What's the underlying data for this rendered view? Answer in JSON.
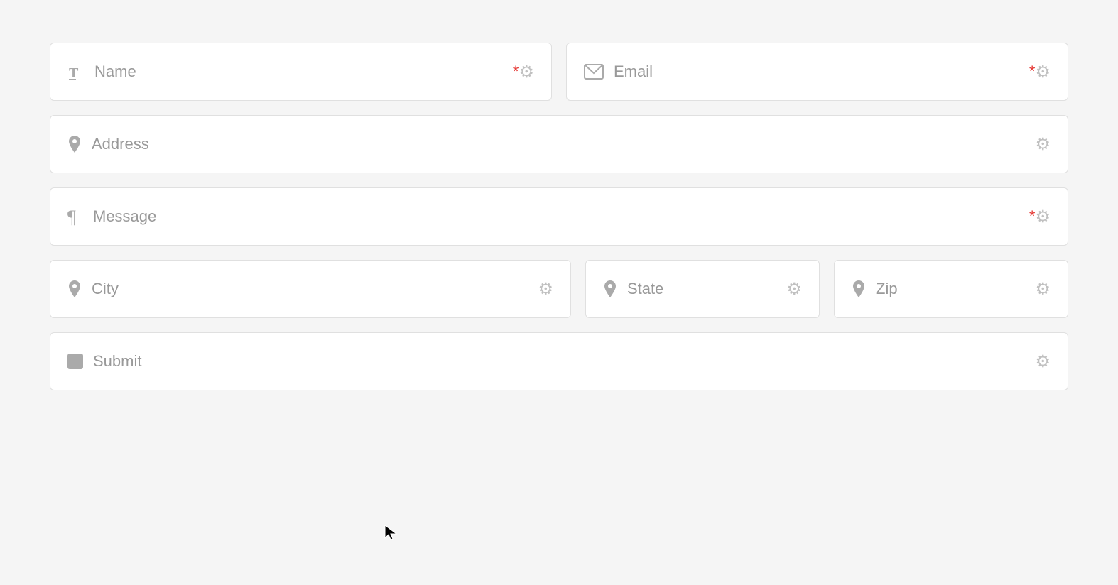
{
  "form": {
    "fields": {
      "name": {
        "label": "Name",
        "required": true,
        "icon": "T",
        "icon_type": "text"
      },
      "email": {
        "label": "Email",
        "required": true,
        "icon": "✉",
        "icon_type": "email"
      },
      "address": {
        "label": "Address",
        "required": false,
        "icon": "📍",
        "icon_type": "location"
      },
      "message": {
        "label": "Message",
        "required": true,
        "icon": "¶",
        "icon_type": "paragraph"
      },
      "city": {
        "label": "City",
        "required": false,
        "icon": "📍",
        "icon_type": "location"
      },
      "state": {
        "label": "State",
        "required": false,
        "icon": "📍",
        "icon_type": "location"
      },
      "zip": {
        "label": "Zip",
        "required": false,
        "icon": "📍",
        "icon_type": "location"
      },
      "submit": {
        "label": "Submit",
        "required": false,
        "icon_type": "button"
      }
    },
    "required_marker": "*",
    "gear_symbol": "⚙"
  }
}
